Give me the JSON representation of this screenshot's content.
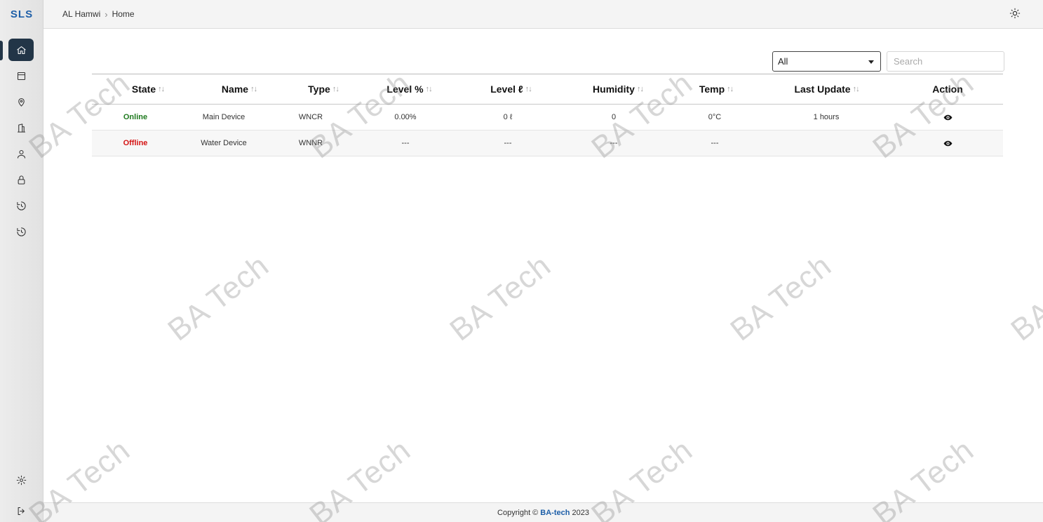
{
  "app": {
    "logo_text": "SLS"
  },
  "breadcrumb": {
    "items": [
      "AL Hamwi",
      "Home"
    ]
  },
  "sidebar": {
    "items": [
      {
        "name": "home-icon",
        "active": true
      },
      {
        "name": "devices-icon",
        "active": false
      },
      {
        "name": "location-pin-icon",
        "active": false
      },
      {
        "name": "building-icon",
        "active": false
      },
      {
        "name": "user-icon",
        "active": false
      },
      {
        "name": "lock-icon",
        "active": false
      },
      {
        "name": "history-icon",
        "active": false
      },
      {
        "name": "history-alt-icon",
        "active": false
      }
    ],
    "bottom_items": [
      {
        "name": "settings-icon"
      },
      {
        "name": "logout-icon"
      }
    ]
  },
  "filter": {
    "selected": "All"
  },
  "search": {
    "placeholder": "Search",
    "value": ""
  },
  "table": {
    "headers": [
      "State",
      "Name",
      "Type",
      "Level %",
      "Level ℓ",
      "Humidity",
      "Temp",
      "Last Update",
      "Action"
    ],
    "sort_indicator": "↑↓",
    "rows": [
      {
        "state": "Online",
        "name": "Main Device",
        "type": "WNCR",
        "level_pct": "0.00%",
        "level_l": "0 ℓ",
        "humidity": "0",
        "temp": "0°C",
        "last_update": "1 hours"
      },
      {
        "state": "Offline",
        "name": "Water Device",
        "type": "WNNR",
        "level_pct": "---",
        "level_l": "---",
        "humidity": "---",
        "temp": "---",
        "last_update": ""
      }
    ]
  },
  "footer": {
    "prefix": "Copyright ©",
    "brand": "BA-tech",
    "year": "2023"
  },
  "watermark": {
    "text": "BA Tech"
  },
  "colors": {
    "online": "#1f7a1f",
    "offline": "#d41414",
    "brand": "#1e5fa8",
    "active_nav": "#223547"
  }
}
